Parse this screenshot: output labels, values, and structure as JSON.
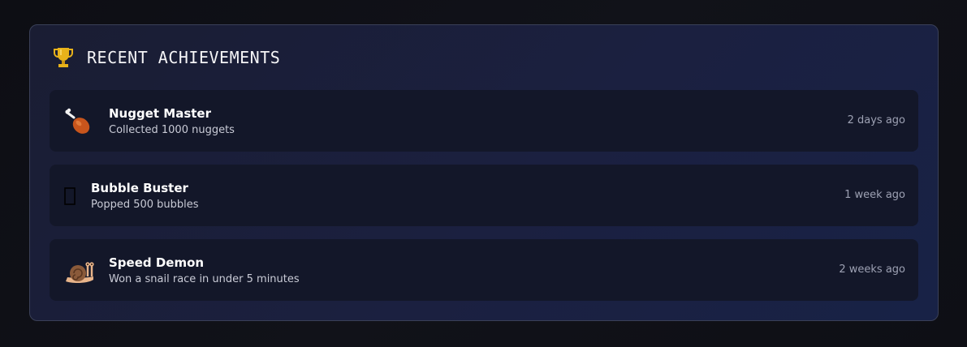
{
  "panel": {
    "icon": "trophy-icon",
    "title": "RECENT ACHIEVEMENTS"
  },
  "achievements": [
    {
      "icon": "drumstick-icon",
      "name": "Nugget Master",
      "description": "Collected 1000 nuggets",
      "time": "2 days ago"
    },
    {
      "icon": "missing-glyph-icon",
      "name": "Bubble Buster",
      "description": "Popped 500 bubbles",
      "time": "1 week ago"
    },
    {
      "icon": "snail-icon",
      "name": "Speed Demon",
      "description": "Won a snail race in under 5 minutes",
      "time": "2 weeks ago"
    }
  ],
  "colors": {
    "background": "#0e0f15",
    "panel": "#1b2040",
    "row": "#131729",
    "trophy": "#e8b21a",
    "drumstick": "#c8551c",
    "snail_shell": "#8a5a3a"
  }
}
